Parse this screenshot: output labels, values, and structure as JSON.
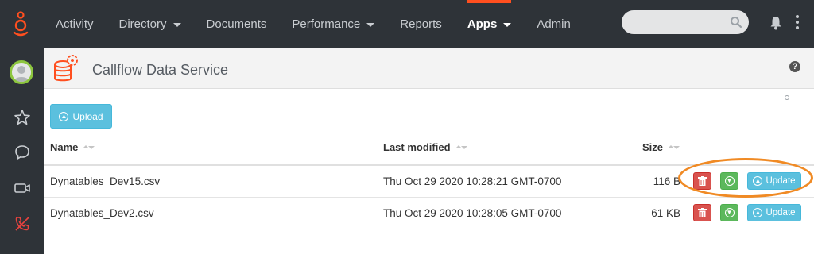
{
  "nav": {
    "items": [
      {
        "label": "Activity",
        "dropdown": false,
        "active": false
      },
      {
        "label": "Directory",
        "dropdown": true,
        "active": false
      },
      {
        "label": "Documents",
        "dropdown": false,
        "active": false
      },
      {
        "label": "Performance",
        "dropdown": true,
        "active": false
      },
      {
        "label": "Reports",
        "dropdown": false,
        "active": false
      },
      {
        "label": "Apps",
        "dropdown": true,
        "active": true
      },
      {
        "label": "Admin",
        "dropdown": false,
        "active": false
      }
    ]
  },
  "search": {
    "placeholder": ""
  },
  "page": {
    "title": "Callflow Data Service",
    "help_label": "?"
  },
  "toolbar": {
    "upload_label": "Upload"
  },
  "table": {
    "headers": {
      "name": "Name",
      "modified": "Last modified",
      "size": "Size"
    },
    "rows": [
      {
        "name": "Dynatables_Dev15.csv",
        "modified": "Thu Oct 29 2020 10:28:21 GMT-0700",
        "size": "116 B",
        "update_label": "Update"
      },
      {
        "name": "Dynatables_Dev2.csv",
        "modified": "Thu Oct 29 2020 10:28:05 GMT-0700",
        "size": "61 KB",
        "update_label": "Update"
      }
    ]
  },
  "colors": {
    "topbar": "#2e3338",
    "accent": "#ff4f1f",
    "info_button": "#5bc0de",
    "danger_button": "#d9534f",
    "success_button": "#5cb85c",
    "highlight_ring": "#f08a24"
  }
}
